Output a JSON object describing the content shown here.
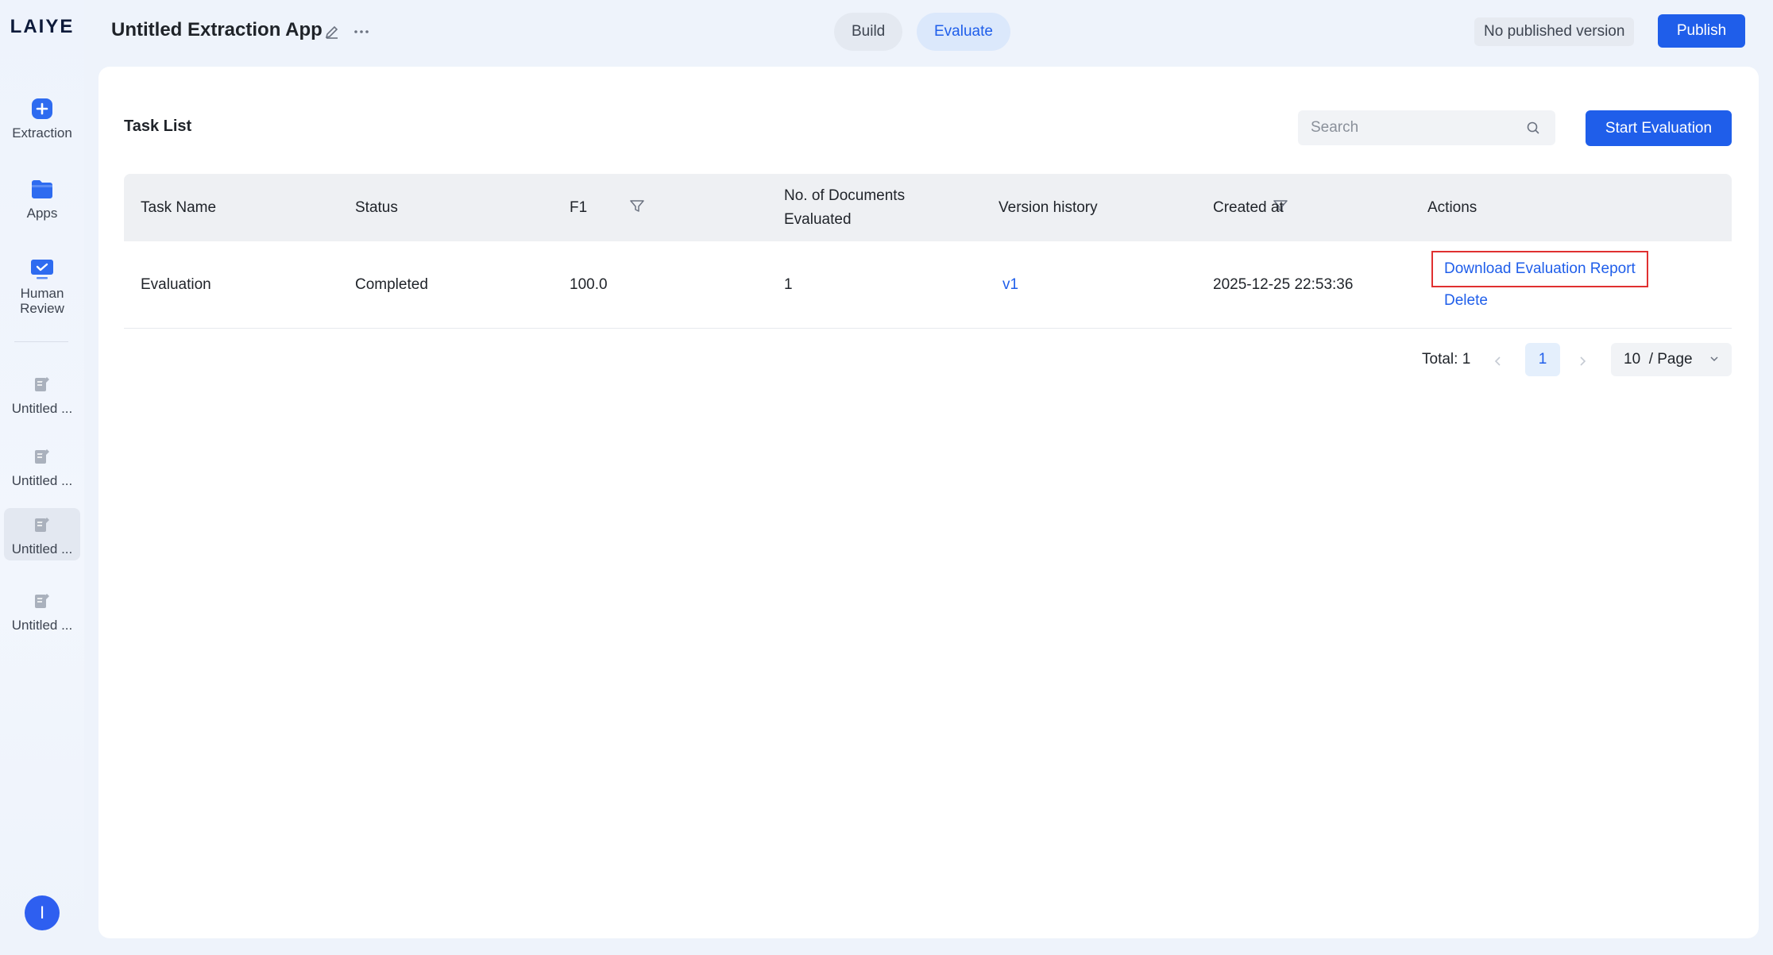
{
  "brand": {
    "logo_text": "LAIYE"
  },
  "sidebar": {
    "items": [
      {
        "label": "Extraction",
        "icon": "plus-circle-icon"
      },
      {
        "label": "Apps",
        "icon": "folder-icon"
      },
      {
        "label": "Human Review",
        "icon": "monitor-check-icon"
      }
    ],
    "recent_apps": [
      {
        "label": "Untitled ..."
      },
      {
        "label": "Untitled ..."
      },
      {
        "label": "Untitled ..."
      },
      {
        "label": "Untitled ..."
      }
    ],
    "avatar_initial": "I"
  },
  "header": {
    "app_title": "Untitled Extraction App",
    "tabs": [
      {
        "label": "Build"
      },
      {
        "label": "Evaluate",
        "active": true
      }
    ],
    "publish_status": "No published version",
    "publish_label": "Publish"
  },
  "main": {
    "title": "Task List",
    "search": {
      "placeholder": "Search",
      "value": ""
    },
    "start_label": "Start Evaluation",
    "table": {
      "columns": [
        "Task Name",
        "Status",
        "F1",
        "No. of Documents Evaluated",
        "Version history",
        "Created at",
        "Actions"
      ],
      "rows": [
        {
          "task_name": "Evaluation",
          "status": "Completed",
          "f1": "100.0",
          "documents": "1",
          "version": "v1",
          "created_at": "2025-12-25 22:53:36",
          "actions": [
            "Download Evaluation Report",
            "Delete"
          ]
        }
      ]
    },
    "pagination": {
      "total_text": "Total: 1",
      "current_page": "1",
      "page_size": "10  / Page"
    }
  },
  "colors": {
    "accent": "#1f5eea",
    "highlight_border": "#e03030",
    "avatar": "#2e5ff0"
  }
}
